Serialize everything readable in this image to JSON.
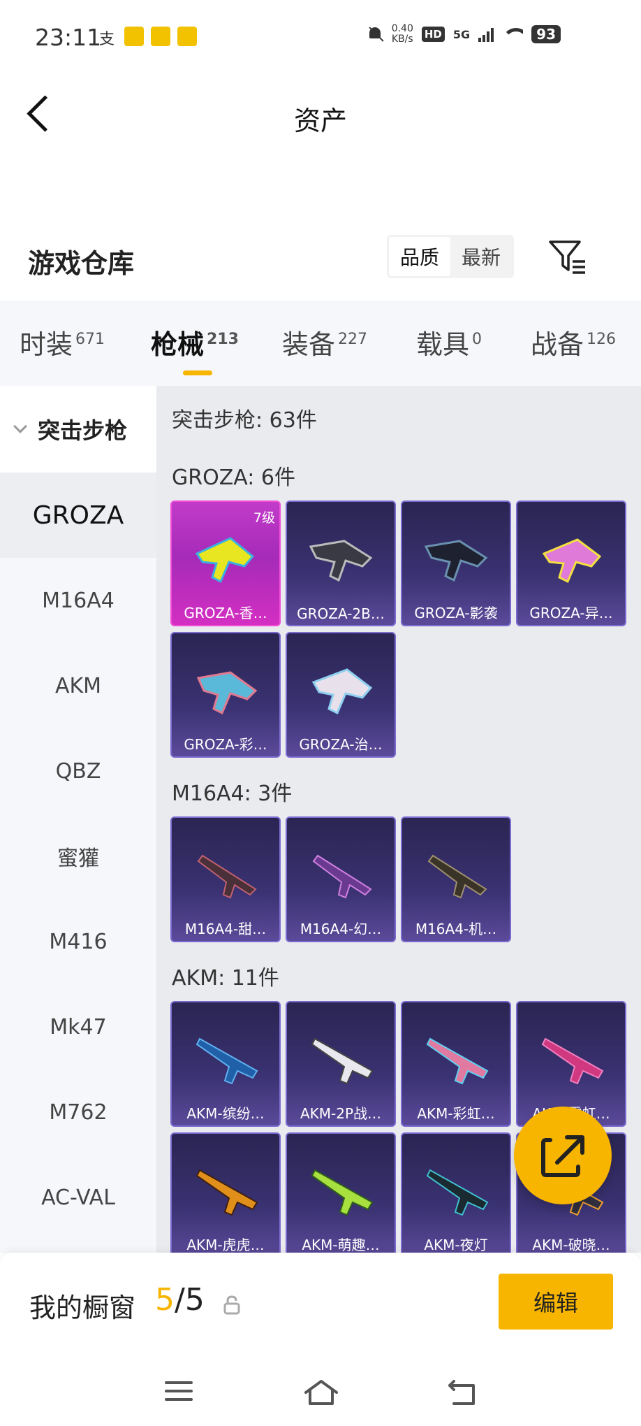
{
  "status_bar": {
    "time": "23:11",
    "net_speed": "0.40",
    "net_unit": "KB/s",
    "hd": "HD",
    "signal": "5G",
    "battery": "93"
  },
  "header": {
    "title": "资产"
  },
  "warehouse": {
    "title": "游戏仓库",
    "sort_options": [
      "品质",
      "最新"
    ],
    "active_sort": 0
  },
  "tabs": [
    {
      "label": "时装",
      "count": "671"
    },
    {
      "label": "枪械",
      "count": "213"
    },
    {
      "label": "装备",
      "count": "227"
    },
    {
      "label": "载具",
      "count": "0"
    },
    {
      "label": "战备",
      "count": "126"
    }
  ],
  "active_tab": 1,
  "sidebar": {
    "category": "突击步枪",
    "items": [
      "GROZA",
      "M16A4",
      "AKM",
      "QBZ",
      "蜜獾",
      "M416",
      "Mk47",
      "M762",
      "AC-VAL"
    ],
    "active": 0
  },
  "content": {
    "summary": "突击步枪: 63件",
    "groups": [
      {
        "title": "GROZA: 6件",
        "items": [
          {
            "name": "GROZA-香…",
            "badge": "7级",
            "rarity": "legendary"
          },
          {
            "name": "GROZA-2B…",
            "rarity": "epic"
          },
          {
            "name": "GROZA-影袭",
            "rarity": "epic"
          },
          {
            "name": "GROZA-异…",
            "rarity": "epic"
          },
          {
            "name": "GROZA-彩…",
            "rarity": "epic"
          },
          {
            "name": "GROZA-治…",
            "rarity": "epic"
          }
        ]
      },
      {
        "title": "M16A4: 3件",
        "items": [
          {
            "name": "M16A4-甜…",
            "rarity": "epic"
          },
          {
            "name": "M16A4-幻…",
            "rarity": "epic"
          },
          {
            "name": "M16A4-机…",
            "rarity": "epic"
          }
        ]
      },
      {
        "title": "AKM: 11件",
        "items": [
          {
            "name": "AKM-缤纷…",
            "rarity": "epic"
          },
          {
            "name": "AKM-2P战…",
            "rarity": "epic"
          },
          {
            "name": "AKM-彩虹…",
            "rarity": "epic"
          },
          {
            "name": "AKM-霓虹…",
            "rarity": "epic"
          },
          {
            "name": "AKM-虎虎…",
            "rarity": "epic"
          },
          {
            "name": "AKM-萌趣…",
            "rarity": "epic"
          },
          {
            "name": "AKM-夜灯",
            "rarity": "epic"
          },
          {
            "name": "AKM-破晓…",
            "rarity": "epic"
          }
        ]
      }
    ]
  },
  "showcase": {
    "label": "我的橱窗",
    "current": "5",
    "total": "/5",
    "edit": "编辑"
  },
  "colors": {
    "accent": "#f7b500",
    "card_epic_top": "#2a2552",
    "card_epic_bottom": "#5b4a9a",
    "card_legendary_top": "#b830c8",
    "card_legendary_bottom": "#e030c0"
  },
  "icons": {
    "back": "chevron-left-icon",
    "filter": "filter-icon",
    "share": "share-external-icon",
    "lock": "lock-icon",
    "nav": [
      "menu-icon",
      "home-icon",
      "back-icon"
    ]
  }
}
